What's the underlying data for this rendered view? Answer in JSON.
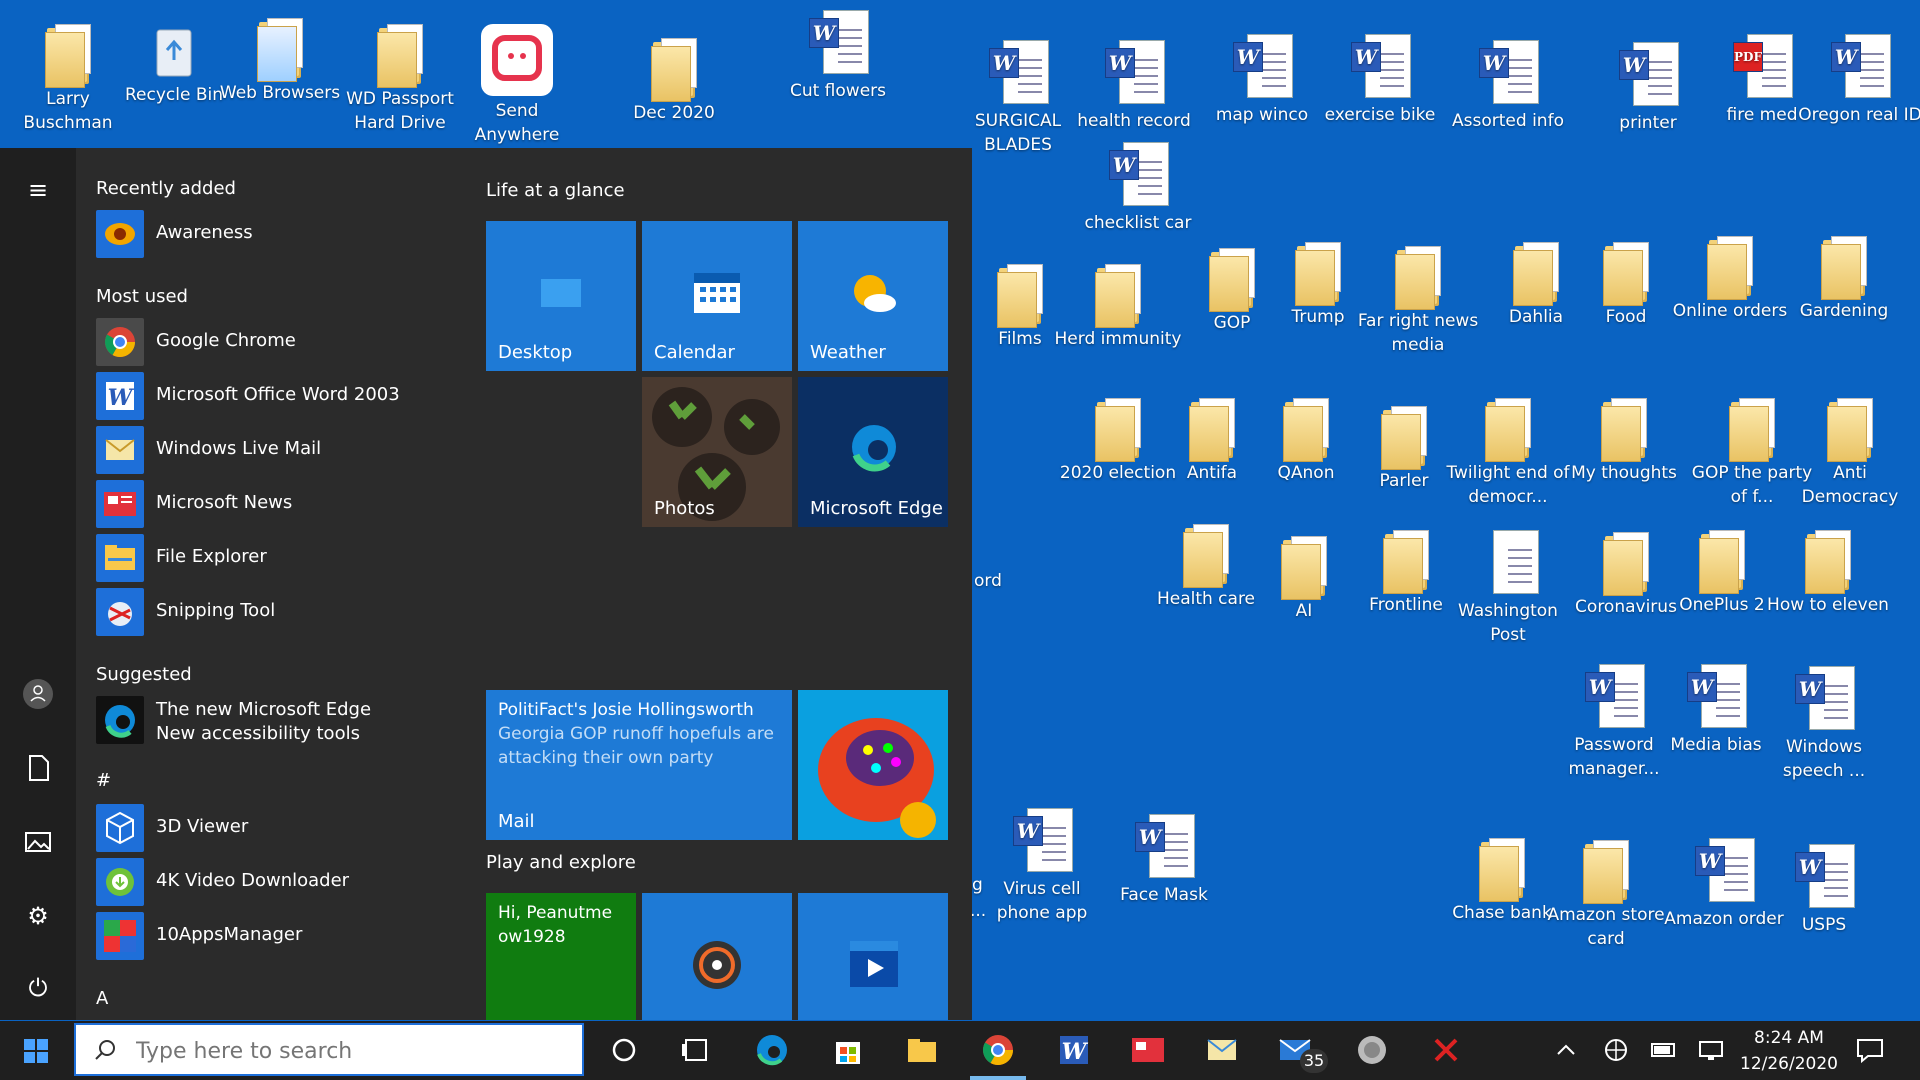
{
  "desktop": {
    "top_row": [
      {
        "label": "Larry Buschman"
      },
      {
        "label": "Recycle Bin"
      },
      {
        "label": "Web Browsers"
      },
      {
        "label": "WD Passport Hard Drive"
      },
      {
        "label": "Send Anywhere"
      },
      {
        "label": "Dec 2020"
      },
      {
        "label": "Cut flowers"
      }
    ],
    "words": [
      "SURGICAL BLADES",
      "health record",
      "map winco",
      "exercise bike",
      "Assorted info",
      "printer",
      "fire med",
      "Oregon real ID",
      "checklist car",
      "Password manager...",
      "Media bias",
      "Windows speech ...",
      "Virus cell phone app",
      "Face Mask",
      "Amazon order",
      "USPS"
    ],
    "folders": [
      "Films",
      "Herd immunity",
      "GOP",
      "Trump",
      "Far right news media",
      "Dahlia",
      "Food",
      "Online orders",
      "Gardening",
      "2020 election",
      "Antifa",
      "QAnon",
      "Parler",
      "Twilight end of democr...",
      "My thoughts",
      "GOP the party of f...",
      "Anti Democracy",
      "Health care",
      "AI",
      "Frontline",
      "Washington Post",
      "Coronavirus",
      "OnePlus 2",
      "How to eleven",
      "Chase bank",
      "Amazon store card"
    ],
    "partial": {
      "ord": "ord",
      "g": "g",
      "dots": "..."
    }
  },
  "start_menu": {
    "recently_added": "Recently added",
    "recent_apps": [
      {
        "label": "Awareness"
      }
    ],
    "most_used": "Most used",
    "most_used_apps": [
      {
        "label": "Google Chrome"
      },
      {
        "label": "Microsoft Office Word 2003"
      },
      {
        "label": "Windows Live Mail"
      },
      {
        "label": "Microsoft News"
      },
      {
        "label": "File Explorer"
      },
      {
        "label": "Snipping Tool"
      }
    ],
    "suggested": "Suggested",
    "suggested_app": {
      "line1": "The new Microsoft Edge",
      "line2": "New accessibility tools"
    },
    "hash": "#",
    "hash_apps": [
      {
        "label": "3D Viewer"
      },
      {
        "label": "4K Video Downloader"
      },
      {
        "label": "10AppsManager"
      }
    ],
    "letter_a": "A",
    "groups": {
      "life": "Life at a glance",
      "play": "Play and explore"
    },
    "tiles": {
      "desktop": "Desktop",
      "calendar": "Calendar",
      "weather": "Weather",
      "photos": "Photos",
      "edge": "Microsoft Edge",
      "mail": "Mail",
      "mail_headline": "PolitiFact's Josie Hollingsworth",
      "mail_body": "Georgia GOP runoff hopefuls are attacking their own party",
      "xbox": "Hi, Peanutmeow1928"
    }
  },
  "taskbar": {
    "search_placeholder": "Type here to search",
    "mail_badge": "35",
    "time": "8:24 AM",
    "date": "12/26/2020"
  }
}
